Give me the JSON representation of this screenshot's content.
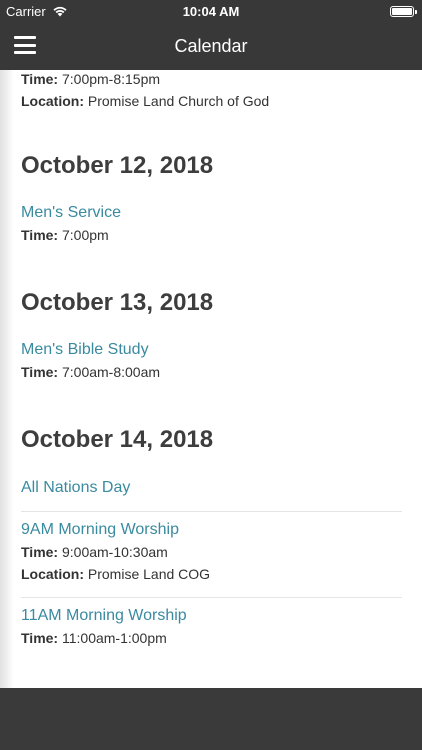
{
  "status_bar": {
    "carrier": "Carrier",
    "time": "10:04 AM"
  },
  "nav": {
    "title": "Calendar"
  },
  "partial_event": {
    "time_label": "Time:",
    "time_value": "7:00pm-8:15pm",
    "location_label": "Location:",
    "location_value": "Promise Land Church of God"
  },
  "days": [
    {
      "date": "October 12, 2018",
      "events": [
        {
          "title": "Men's Service",
          "time_label": "Time:",
          "time": "7:00pm"
        }
      ]
    },
    {
      "date": "October 13, 2018",
      "events": [
        {
          "title": "Men's Bible Study",
          "time_label": "Time:",
          "time": "7:00am-8:00am"
        }
      ]
    },
    {
      "date": "October 14, 2018",
      "events": [
        {
          "title": "All Nations Day"
        },
        {
          "title": "9AM Morning Worship",
          "time_label": "Time:",
          "time": "9:00am-10:30am",
          "location_label": "Location:",
          "location": "Promise Land COG"
        },
        {
          "title": "11AM Morning Worship",
          "time_label": "Time:",
          "time": "11:00am-1:00pm"
        }
      ]
    }
  ],
  "colors": {
    "bar": "#383838",
    "link": "#3a8aa0",
    "heading": "#3d3d3d"
  }
}
